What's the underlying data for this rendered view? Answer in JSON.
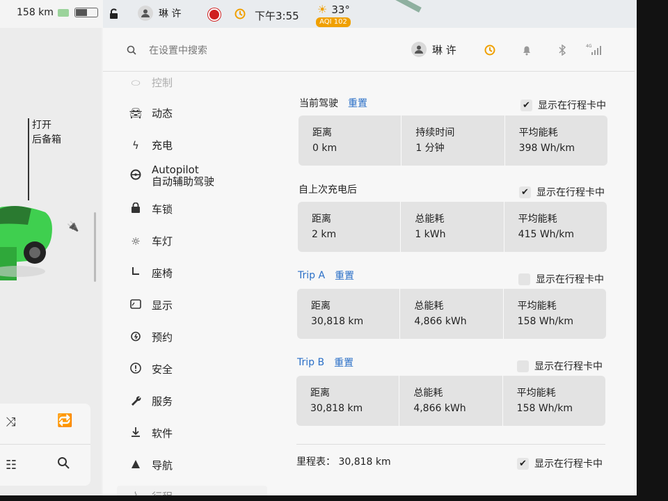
{
  "status_bar": {
    "range": "158 km",
    "user": "琳 许",
    "time": "下午3:55",
    "temperature": "33°",
    "aqi": "AQI 102"
  },
  "left_panel": {
    "trunk_line1": "打开",
    "trunk_line2": "后备箱"
  },
  "search": {
    "placeholder": "在设置中搜索"
  },
  "top_user": "琳 许",
  "menu": [
    {
      "label": "控制",
      "icon": "toggle-icon"
    },
    {
      "label": "动态",
      "icon": "car-icon"
    },
    {
      "label": "充电",
      "icon": "bolt-icon"
    },
    {
      "label": "Autopilot",
      "label2": "自动辅助驾驶",
      "icon": "steering-wheel-icon"
    },
    {
      "label": "车锁",
      "icon": "lock-icon"
    },
    {
      "label": "车灯",
      "icon": "light-icon"
    },
    {
      "label": "座椅",
      "icon": "seat-icon"
    },
    {
      "label": "显示",
      "icon": "display-icon"
    },
    {
      "label": "预约",
      "icon": "schedule-icon"
    },
    {
      "label": "安全",
      "icon": "safety-icon"
    },
    {
      "label": "服务",
      "icon": "wrench-icon"
    },
    {
      "label": "软件",
      "icon": "download-icon"
    },
    {
      "label": "导航",
      "icon": "navigation-icon"
    },
    {
      "label": "行程",
      "icon": "trips-icon"
    }
  ],
  "show_label": "显示在行程卡中",
  "reset_label": "重置",
  "sections": [
    {
      "title": "当前驾驶",
      "has_reset": true,
      "checked": true,
      "cells": [
        {
          "label": "距离",
          "value": "0 km"
        },
        {
          "label": "持续时间",
          "value": "1 分钟"
        },
        {
          "label": "平均能耗",
          "value": "398 Wh/km"
        }
      ]
    },
    {
      "title": "自上次充电后",
      "has_reset": false,
      "checked": true,
      "cells": [
        {
          "label": "距离",
          "value": "2 km"
        },
        {
          "label": "总能耗",
          "value": "1 kWh"
        },
        {
          "label": "平均能耗",
          "value": "415 Wh/km"
        }
      ]
    },
    {
      "title": "Trip A",
      "has_reset": true,
      "checked": false,
      "cells": [
        {
          "label": "距离",
          "value": "30,818 km"
        },
        {
          "label": "总能耗",
          "value": "4,866 kWh"
        },
        {
          "label": "平均能耗",
          "value": "158 Wh/km"
        }
      ]
    },
    {
      "title": "Trip B",
      "has_reset": true,
      "checked": false,
      "cells": [
        {
          "label": "距离",
          "value": "30,818 km"
        },
        {
          "label": "总能耗",
          "value": "4,866 kWh"
        },
        {
          "label": "平均能耗",
          "value": "158 Wh/km"
        }
      ]
    }
  ],
  "odometer": {
    "label": "里程表：",
    "value": "30,818 km",
    "checked": true
  },
  "colors": {
    "accent": "#2a6fc7",
    "trip_title": "#2a6fc7",
    "car_green": "#3fcf4f"
  }
}
